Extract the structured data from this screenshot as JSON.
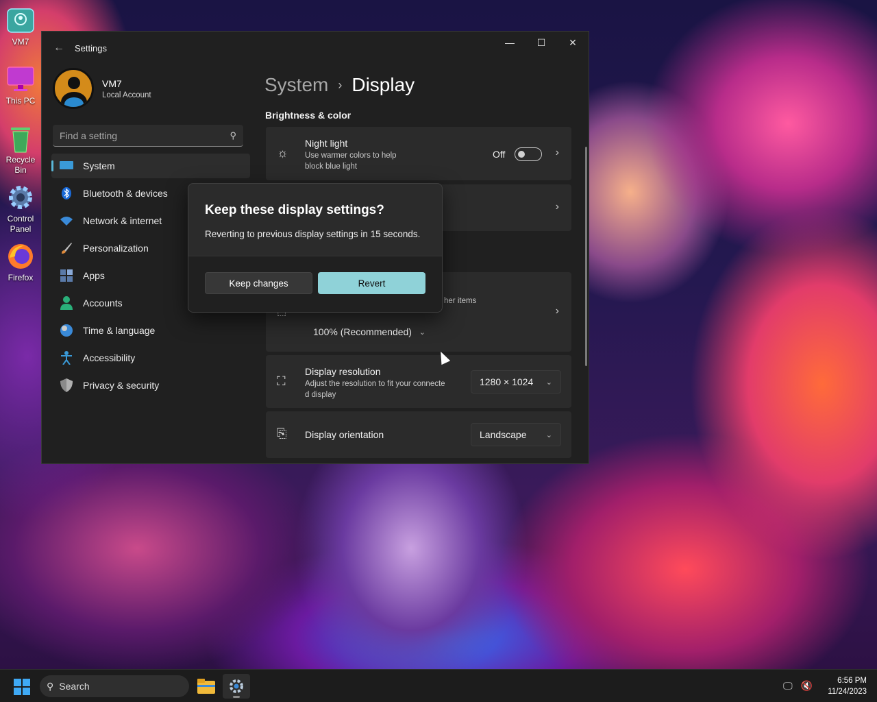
{
  "desktop": {
    "icons": [
      {
        "label": "VM7",
        "icon": "user-folder-icon"
      },
      {
        "label": "This PC",
        "icon": "monitor-icon"
      },
      {
        "label": "Recycle Bin",
        "icon": "recycle-bin-icon"
      },
      {
        "label": "Control Panel",
        "icon": "gear-icon"
      },
      {
        "label": "Firefox",
        "icon": "firefox-icon"
      }
    ]
  },
  "window": {
    "title": "Settings",
    "controls": {
      "minimize": "—",
      "maximize": "☐",
      "close": "✕"
    }
  },
  "profile": {
    "name": "VM7",
    "account_type": "Local Account"
  },
  "search": {
    "placeholder": "Find a setting"
  },
  "nav": {
    "items": [
      {
        "label": "System",
        "icon": "system-icon",
        "active": true
      },
      {
        "label": "Bluetooth & devices",
        "icon": "bluetooth-icon"
      },
      {
        "label": "Network & internet",
        "icon": "wifi-icon"
      },
      {
        "label": "Personalization",
        "icon": "brush-icon"
      },
      {
        "label": "Apps",
        "icon": "apps-icon"
      },
      {
        "label": "Accounts",
        "icon": "person-icon"
      },
      {
        "label": "Time & language",
        "icon": "globe-clock-icon"
      },
      {
        "label": "Accessibility",
        "icon": "accessibility-icon"
      },
      {
        "label": "Privacy & security",
        "icon": "shield-icon"
      }
    ]
  },
  "main": {
    "breadcrumb": {
      "parent": "System",
      "separator": "›",
      "current": "Display"
    },
    "section_brightness": "Brightness & color",
    "night_light": {
      "title": "Night light",
      "subtitle_line1": "Use warmer colors to help",
      "subtitle_line2": "block blue light",
      "state": "Off"
    },
    "scale": {
      "partial_text": "her items",
      "value": "100% (Recommended)"
    },
    "resolution": {
      "title": "Display resolution",
      "subtitle_line1": "Adjust the resolution to fit your connecte",
      "subtitle_line2": "d display",
      "value": "1280 × 1024"
    },
    "orientation": {
      "title": "Display orientation",
      "value": "Landscape"
    }
  },
  "dialog": {
    "title": "Keep these display settings?",
    "message": "Reverting to previous display settings in 15 seconds.",
    "keep_label": "Keep changes",
    "revert_label": "Revert",
    "accent": "#8fd2d8"
  },
  "taskbar": {
    "search_label": "Search",
    "time": "6:56 PM",
    "date": "11/24/2023"
  }
}
